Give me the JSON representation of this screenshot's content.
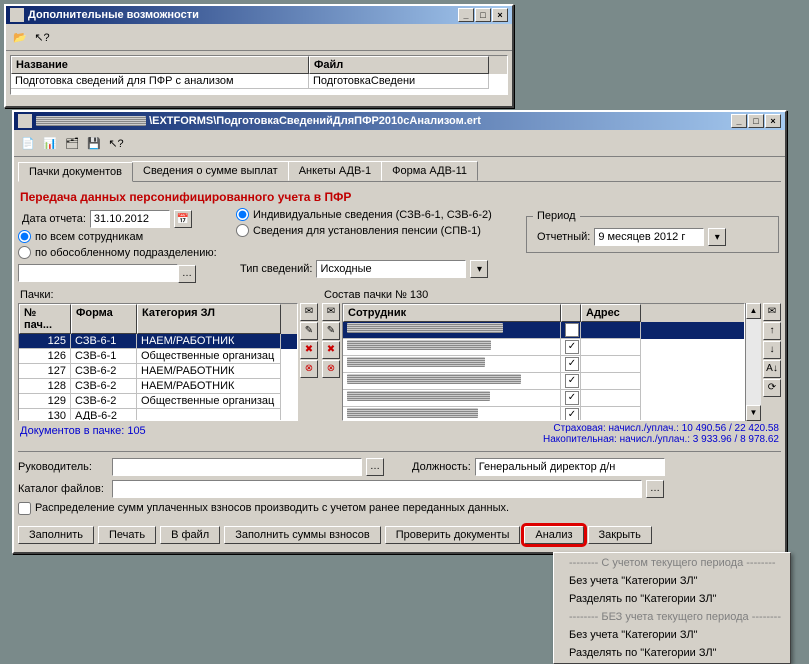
{
  "win1": {
    "title": "Дополнительные возможности",
    "col_name": "Название",
    "col_file": "Файл",
    "row_name": "Подготовка сведений для ПФР с анализом",
    "row_file": "ПодготовкаСведени"
  },
  "win2": {
    "title_prefix": "\\EXTFORMS\\ПодготовкаСведенийДляПФР2010сАнализом.ert",
    "tabs": [
      "Пачки документов",
      "Сведения о сумме выплат",
      "Анкеты АДВ-1",
      "Форма АДВ-11"
    ],
    "red_title": "Передача данных персонифицированного учета в ПФР",
    "date_label": "Дата отчета:",
    "date_value": "31.10.2012",
    "radio_all": "по всем сотрудникам",
    "radio_dept": "по обособленному подразделению:",
    "radio_ind": "Индивидуальные сведения (СЗВ-6-1, СЗВ-6-2)",
    "radio_spv": "Сведения для установления пенсии (СПВ-1)",
    "type_label": "Тип сведений:",
    "type_value": "Исходные",
    "period_legend": "Период",
    "period_label": "Отчетный:",
    "period_value": "9 месяцев 2012 г",
    "packs_label": "Пачки:",
    "pack_contain_label": "Состав пачки № 130",
    "cols1": [
      "№ пач...",
      "Форма",
      "Категория ЗЛ"
    ],
    "rows1": [
      {
        "n": "125",
        "f": "СЗВ-6-1",
        "c": "НАЕМ/РАБОТНИК"
      },
      {
        "n": "126",
        "f": "СЗВ-6-1",
        "c": "Общественные организац"
      },
      {
        "n": "127",
        "f": "СЗВ-6-2",
        "c": "НАЕМ/РАБОТНИК"
      },
      {
        "n": "128",
        "f": "СЗВ-6-2",
        "c": "НАЕМ/РАБОТНИК"
      },
      {
        "n": "129",
        "f": "СЗВ-6-2",
        "c": "Общественные организац"
      },
      {
        "n": "130",
        "f": "АДВ-6-2",
        "c": ""
      }
    ],
    "cols2": [
      "Сотрудник",
      "",
      "Адрес"
    ],
    "docs_in_pack": "Документов в пачке: 105",
    "strah": "Страховая: начисл./уплач.: 10 490.56 / 22 420.58",
    "nakop": "Накопительная: начисл./уплач.: 3 933.96 / 8 978.62",
    "ruk_label": "Руководитель:",
    "dolzh_label": "Должность:",
    "dolzh_value": "Генеральный директор д/н",
    "katalog_label": "Каталог файлов:",
    "raspr_label": "Распределение сумм уплаченных взносов производить с учетом ранее переданных данных.",
    "buttons": [
      "Заполнить",
      "Печать",
      "В файл",
      "Заполнить суммы взносов",
      "Проверить документы",
      "Анализ",
      "Закрыть"
    ]
  },
  "menu": {
    "items": [
      "--------   С учетом текущего периода   --------",
      "Без учета \"Категории ЗЛ\"",
      "Разделять по \"Категории ЗЛ\"",
      "--------   БЕЗ учета текущего периода   --------",
      "Без учета \"Категории ЗЛ\"",
      "Разделять по \"Категории ЗЛ\""
    ]
  }
}
